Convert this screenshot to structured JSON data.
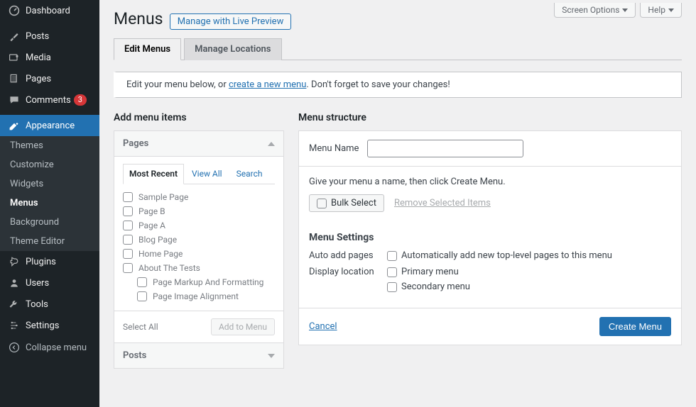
{
  "topButtons": {
    "screenOptions": "Screen Options",
    "help": "Help"
  },
  "sidebar": {
    "items": [
      {
        "label": "Dashboard"
      },
      {
        "label": "Posts"
      },
      {
        "label": "Media"
      },
      {
        "label": "Pages"
      },
      {
        "label": "Comments",
        "badge": "3"
      },
      {
        "label": "Appearance"
      },
      {
        "label": "Plugins"
      },
      {
        "label": "Users"
      },
      {
        "label": "Tools"
      },
      {
        "label": "Settings"
      }
    ],
    "appearanceSub": [
      "Themes",
      "Customize",
      "Widgets",
      "Menus",
      "Background",
      "Theme Editor"
    ],
    "collapse": "Collapse menu"
  },
  "header": {
    "title": "Menus",
    "livePreview": "Manage with Live Preview",
    "tabs": [
      "Edit Menus",
      "Manage Locations"
    ]
  },
  "notice": {
    "pre": "Edit your menu below, or ",
    "link": "create a new menu",
    "post": ". Don't forget to save your changes!"
  },
  "left": {
    "heading": "Add menu items",
    "accordion": [
      {
        "title": "Pages",
        "open": true
      },
      {
        "title": "Posts",
        "open": false
      }
    ],
    "innerTabs": [
      "Most Recent",
      "View All",
      "Search"
    ],
    "pages": [
      {
        "label": "Sample Page",
        "indent": 0
      },
      {
        "label": "Page B",
        "indent": 0
      },
      {
        "label": "Page A",
        "indent": 0
      },
      {
        "label": "Blog Page",
        "indent": 0
      },
      {
        "label": "Home Page",
        "indent": 0
      },
      {
        "label": "About The Tests",
        "indent": 0
      },
      {
        "label": "Page Markup And Formatting",
        "indent": 1
      },
      {
        "label": "Page Image Alignment",
        "indent": 1
      }
    ],
    "selectAll": "Select All",
    "addToMenu": "Add to Menu"
  },
  "right": {
    "heading": "Menu structure",
    "menuNameLabel": "Menu Name",
    "menuNameValue": "",
    "intro": "Give your menu a name, then click Create Menu.",
    "bulkSelect": "Bulk Select",
    "removeSelected": "Remove Selected Items",
    "settingsTitle": "Menu Settings",
    "autoAdd": {
      "label": "Auto add pages",
      "option": "Automatically add new top-level pages to this menu"
    },
    "displayLoc": {
      "label": "Display location",
      "options": [
        "Primary menu",
        "Secondary menu"
      ]
    },
    "cancel": "Cancel",
    "createMenu": "Create Menu"
  }
}
